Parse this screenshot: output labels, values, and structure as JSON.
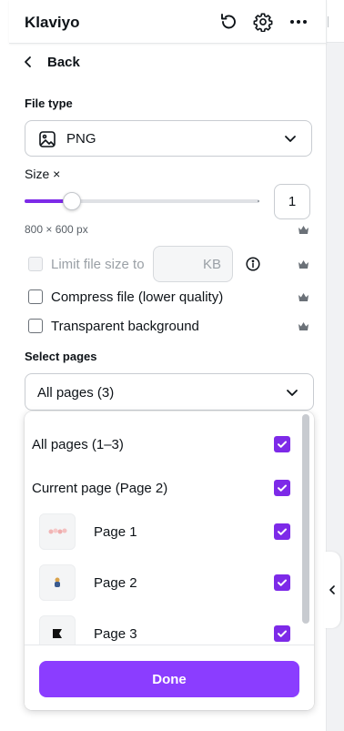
{
  "header": {
    "title": "Klaviyo",
    "icons": [
      "refresh-icon",
      "gear-icon",
      "more-icon"
    ]
  },
  "back": {
    "label": "Back"
  },
  "file_type": {
    "label": "File type",
    "value": "PNG",
    "icon": "image-icon"
  },
  "size": {
    "label": "Size ×",
    "value": "1",
    "slider_fraction": 0.2,
    "dimensions": "800 × 600 px"
  },
  "options": {
    "limit": {
      "label": "Limit file size to",
      "unit": "KB",
      "checked": false,
      "disabled": true
    },
    "compress": {
      "label": "Compress file (lower quality)",
      "checked": false
    },
    "transparent": {
      "label": "Transparent background",
      "checked": false
    }
  },
  "select_pages": {
    "label": "Select pages",
    "value": "All pages (3)"
  },
  "dropdown": {
    "items": [
      {
        "label": "All pages (1–3)",
        "checked": true
      },
      {
        "label": "Current page (Page 2)",
        "checked": true
      },
      {
        "label": "Page 1",
        "checked": true
      },
      {
        "label": "Page 2",
        "checked": true
      },
      {
        "label": "Page 3",
        "checked": true
      }
    ],
    "done_label": "Done"
  },
  "colors": {
    "accent": "#7d2ae8",
    "done": "#8b3dff"
  }
}
